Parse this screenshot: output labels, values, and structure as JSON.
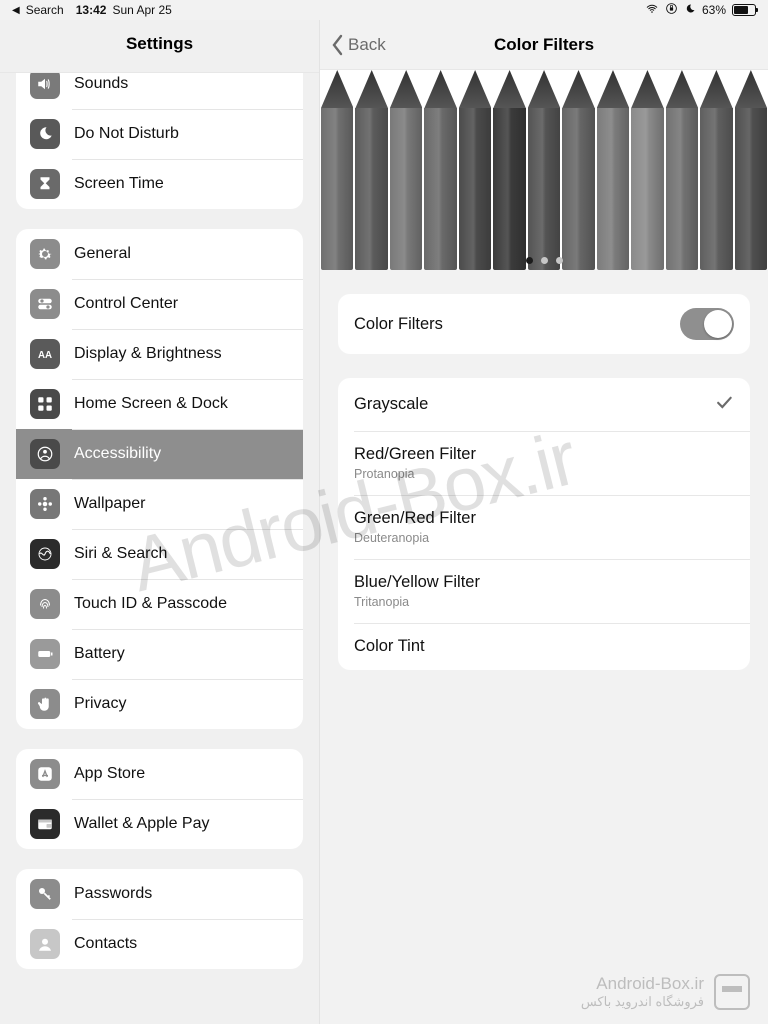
{
  "status": {
    "back_app": "Search",
    "time": "13:42",
    "date": "Sun Apr 25",
    "battery": "63%"
  },
  "sidebar_title": "Settings",
  "groups": [
    {
      "first": true,
      "items": [
        {
          "name": "sounds",
          "label": "Sounds",
          "icon": "speaker",
          "bg": "#7a7a7a"
        },
        {
          "name": "dnd",
          "label": "Do Not Disturb",
          "icon": "moon",
          "bg": "#595959"
        },
        {
          "name": "screen-time",
          "label": "Screen Time",
          "icon": "hourglass",
          "bg": "#6a6a6a"
        }
      ]
    },
    {
      "items": [
        {
          "name": "general",
          "label": "General",
          "icon": "gear",
          "bg": "#8c8c8c"
        },
        {
          "name": "control-center",
          "label": "Control Center",
          "icon": "toggles",
          "bg": "#8c8c8c"
        },
        {
          "name": "display",
          "label": "Display & Brightness",
          "icon": "aa",
          "bg": "#5a5a5a"
        },
        {
          "name": "home-dock",
          "label": "Home Screen & Dock",
          "icon": "grid",
          "bg": "#4a4a4a"
        },
        {
          "name": "accessibility",
          "label": "Accessibility",
          "icon": "person",
          "bg": "#4a4a4a",
          "selected": true
        },
        {
          "name": "wallpaper",
          "label": "Wallpaper",
          "icon": "flower",
          "bg": "#777777"
        },
        {
          "name": "siri",
          "label": "Siri & Search",
          "icon": "siri",
          "bg": "#2b2b2b"
        },
        {
          "name": "touchid",
          "label": "Touch ID & Passcode",
          "icon": "fingerprint",
          "bg": "#8c8c8c"
        },
        {
          "name": "battery",
          "label": "Battery",
          "icon": "battery",
          "bg": "#9a9a9a"
        },
        {
          "name": "privacy",
          "label": "Privacy",
          "icon": "hand",
          "bg": "#8c8c8c"
        }
      ]
    },
    {
      "items": [
        {
          "name": "app-store",
          "label": "App Store",
          "icon": "appstore",
          "bg": "#8c8c8c"
        },
        {
          "name": "wallet",
          "label": "Wallet & Apple Pay",
          "icon": "wallet",
          "bg": "#2b2b2b"
        }
      ]
    },
    {
      "items": [
        {
          "name": "passwords",
          "label": "Passwords",
          "icon": "key",
          "bg": "#8c8c8c"
        },
        {
          "name": "contacts",
          "label": "Contacts",
          "icon": "contact",
          "bg": "#c7c7c7"
        }
      ]
    }
  ],
  "detail": {
    "back_label": "Back",
    "title": "Color Filters",
    "toggle_label": "Color Filters",
    "toggle_on": true,
    "page_dots": 3,
    "active_dot": 0,
    "filters": [
      {
        "label": "Grayscale",
        "sub": "",
        "checked": true
      },
      {
        "label": "Red/Green Filter",
        "sub": "Protanopia",
        "checked": false
      },
      {
        "label": "Green/Red Filter",
        "sub": "Deuteranopia",
        "checked": false
      },
      {
        "label": "Blue/Yellow Filter",
        "sub": "Tritanopia",
        "checked": false
      },
      {
        "label": "Color Tint",
        "sub": "",
        "checked": false
      }
    ]
  },
  "pencil_shades": [
    "#6f6f6f",
    "#5c5c5c",
    "#797979",
    "#6a6a6a",
    "#4b4b4b",
    "#3b3b3b",
    "#545454",
    "#666666",
    "#7c7c7c",
    "#8a8a8a",
    "#727272",
    "#5f5f5f",
    "#4f4f4f"
  ],
  "watermark": {
    "big": "Android-Box.ir",
    "line1": "Android-Box.ir",
    "line2": "فروشگاه اندروید باکس"
  },
  "icons": {
    "speaker": "<path d='M3 9v6h4l5 4V5L7 9H3z' fill='#fff'/><path d='M14 8c1 1 1 7 0 8M16 6c2 2 2 10 0 12' stroke='#fff' fill='none' stroke-width='1.5'/>",
    "moon": "<path d='M14 3a8 8 0 1 0 7 11 7 7 0 0 1-7-11z' fill='#fff'/>",
    "hourglass": "<path d='M6 3h12v3l-5 5 5 5v3H6v-3l5-5-5-5V3z' fill='#fff'/>",
    "gear": "<path d='M12 8a4 4 0 1 0 0 8 4 4 0 0 0 0-8zm9 4l-2 .5-.7 1.7 1 1.8-1.4 1.4-1.8-1-1.7.7-.5 2h-2l-.5-2-1.7-.7-1.8 1L4.5 16l1-1.8L4.8 12.5 3 12l1.8-.5.7-1.7-1-1.8L5.9 6.6l1.8 1 1.7-.7.5-2h2l.5 2 1.7.7 1.8-1 1.4 1.4-1 1.8.7 1.7L21 12z' fill='#fff'/>",
    "toggles": "<rect x='3' y='5' width='18' height='6' rx='3' fill='#fff'/><circle cx='8' cy='8' r='2.2' fill='#8c8c8c'/><rect x='3' y='13' width='18' height='6' rx='3' fill='#fff'/><circle cx='16' cy='16' r='2.2' fill='#8c8c8c'/>",
    "aa": "<text x='12' y='17' text-anchor='middle' font-size='13' font-weight='700' fill='#fff' font-family='Arial'>AA</text>",
    "grid": "<rect x='3' y='3' width='7' height='7' rx='1.5' fill='#fff'/><rect x='14' y='3' width='7' height='7' rx='1.5' fill='#fff'/><rect x='3' y='14' width='7' height='7' rx='1.5' fill='#fff'/><rect x='14' y='14' width='7' height='7' rx='1.5' fill='#fff'/>",
    "person": "<circle cx='12' cy='12' r='9' fill='none' stroke='#fff' stroke-width='1.6'/><circle cx='12' cy='9' r='2.5' fill='#fff'/><path d='M6 19c1-3 4-4 6-4s5 1 6 4' stroke='#fff' stroke-width='1.6' fill='none'/>",
    "flower": "<circle cx='12' cy='12' r='3' fill='#fff'/><circle cx='12' cy='5' r='2.3' fill='#fff'/><circle cx='12' cy='19' r='2.3' fill='#fff'/><circle cx='5' cy='12' r='2.3' fill='#fff'/><circle cx='19' cy='12' r='2.3' fill='#fff'/>",
    "siri": "<circle cx='12' cy='12' r='8' fill='none' stroke='#fff' stroke-width='1.2'/><path d='M5 12c2-5 5 5 7 0s5-5 7 0' stroke='#fff' fill='none' stroke-width='1.4'/>",
    "fingerprint": "<path d='M6 14c0-5 3-8 6-8s6 3 6 8M8 16c0-4 2-6 4-6s4 2 4 6M10 18c0-3 1-4 2-4s2 1 2 4' stroke='#fff' fill='none' stroke-width='1.3'/>",
    "battery": "<rect x='3' y='8' width='16' height='8' rx='2' fill='#fff'/><rect x='20' y='10' width='2' height='4' fill='#fff'/>",
    "hand": "<path d='M8 12V6a1.5 1.5 0 1 1 3 0v5V5a1.5 1.5 0 1 1 3 0v6V6a1.5 1.5 0 1 1 3 0v9c0 3-2 6-6 6s-6-3-6-6l-2-3a1.5 1.5 0 1 1 2.5-1.5L8 12z' fill='#fff'/>",
    "appstore": "<rect x='3' y='3' width='18' height='18' rx='4' fill='#fff'/><path d='M9 16l3-8 3 8M8 14h8' stroke='#8c8c8c' stroke-width='1.8' fill='none'/>",
    "wallet": "<rect x='3' y='6' width='18' height='13' rx='2' fill='#fff'/><rect x='3' y='6' width='18' height='4' fill='#c8c8c8'/><rect x='14' y='12' width='7' height='5' rx='1' fill='#c8c8c8'/>",
    "key": "<circle cx='8' cy='8' r='4' fill='#fff'/><path d='M11 11l8 8m-3-3l2-2' stroke='#fff' stroke-width='2.2'/>",
    "contact": "<circle cx='12' cy='9' r='4' fill='#fff'/><path d='M4 21c1-4 5-6 8-6s7 2 8 6' fill='#fff'/>"
  }
}
